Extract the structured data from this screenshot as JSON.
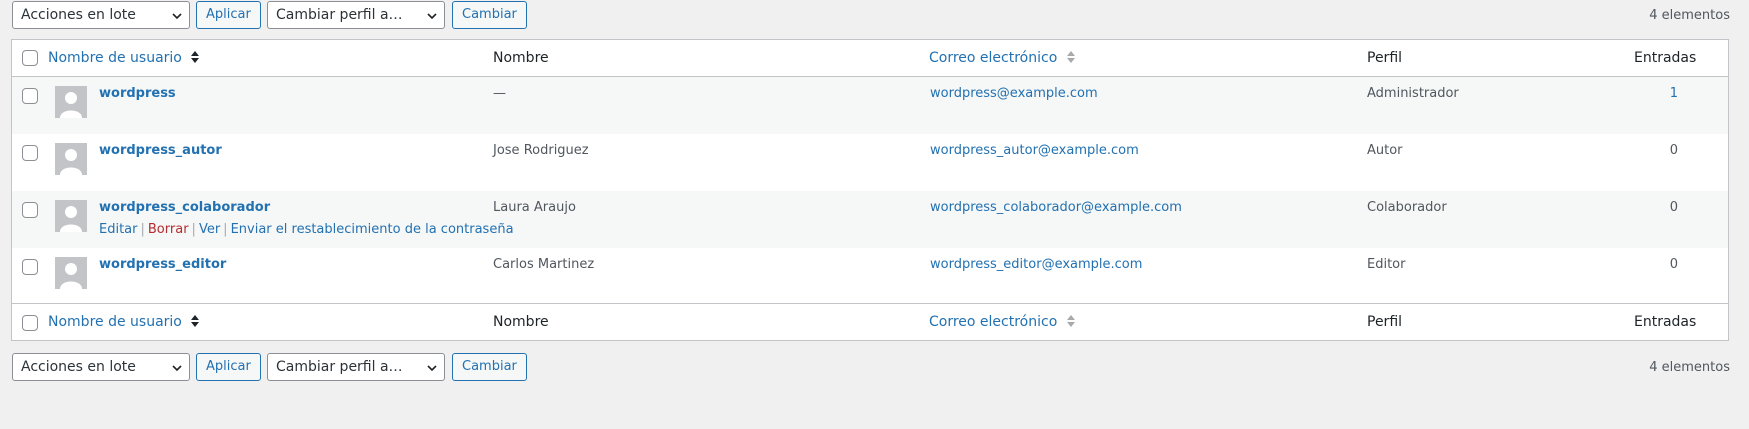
{
  "top_nav": {
    "bulk_actions": "Acciones en lote",
    "apply": "Aplicar",
    "change_role": "Cambiar perfil a…",
    "change": "Cambiar",
    "count": "4 elementos"
  },
  "bottom_nav": {
    "bulk_actions": "Acciones en lote",
    "apply": "Aplicar",
    "change_role": "Cambiar perfil a…",
    "change": "Cambiar",
    "count": "4 elementos"
  },
  "columns": {
    "username": "Nombre de usuario",
    "name": "Nombre",
    "email": "Correo electrónico",
    "role": "Perfil",
    "posts": "Entradas"
  },
  "users": [
    {
      "username": "wordpress",
      "name": "—",
      "email": "wordpress@example.com",
      "role": "Administrador",
      "posts": "1"
    },
    {
      "username": "wordpress_autor",
      "name": "Jose Rodriguez",
      "email": "wordpress_autor@example.com",
      "role": "Autor",
      "posts": "0"
    },
    {
      "username": "wordpress_colaborador",
      "name": "Laura Araujo",
      "email": "wordpress_colaborador@example.com",
      "role": "Colaborador",
      "posts": "0"
    },
    {
      "username": "wordpress_editor",
      "name": "Carlos Martinez",
      "email": "wordpress_editor@example.com",
      "role": "Editor",
      "posts": "0"
    }
  ],
  "row_actions": {
    "edit": "Editar",
    "delete": "Borrar",
    "view": "Ver",
    "reset_password": "Enviar el restablecimiento de la contraseña"
  },
  "colors": {
    "link": "#2271b1",
    "delete": "#b32d2e",
    "background": "#f0f0f1"
  },
  "icons": {
    "dropdown": "chevron-down-icon",
    "sort": "sort-arrows-icon",
    "avatar": "default-avatar-icon"
  }
}
